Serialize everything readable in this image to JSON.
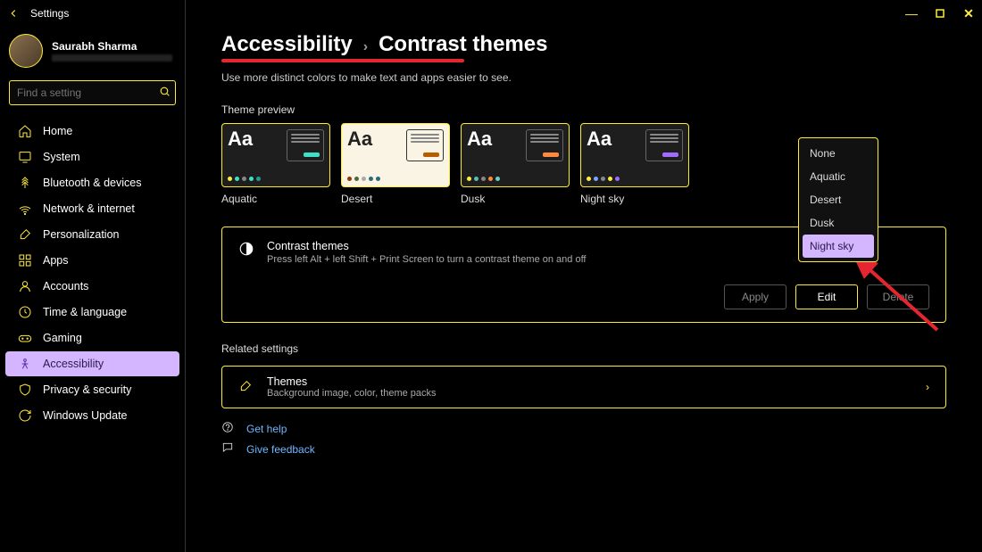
{
  "app": {
    "title": "Settings"
  },
  "user": {
    "name": "Saurabh Sharma"
  },
  "search": {
    "placeholder": "Find a setting"
  },
  "nav": {
    "items": [
      {
        "label": "Home"
      },
      {
        "label": "System"
      },
      {
        "label": "Bluetooth & devices"
      },
      {
        "label": "Network & internet"
      },
      {
        "label": "Personalization"
      },
      {
        "label": "Apps"
      },
      {
        "label": "Accounts"
      },
      {
        "label": "Time & language"
      },
      {
        "label": "Gaming"
      },
      {
        "label": "Accessibility"
      },
      {
        "label": "Privacy & security"
      },
      {
        "label": "Windows Update"
      }
    ],
    "active_index": 9
  },
  "breadcrumb": {
    "parent": "Accessibility",
    "sep": "›",
    "current": "Contrast themes"
  },
  "description": "Use more distinct colors to make text and apps easier to see.",
  "preview_label": "Theme preview",
  "themes": [
    {
      "name": "Aquatic",
      "bg": "dark",
      "accent": "#3fe0c5",
      "dots": [
        "#ffeb3b",
        "#3fe0c5",
        "#888",
        "#3fe0c5",
        "#209e8a"
      ]
    },
    {
      "name": "Desert",
      "bg": "light",
      "accent": "#b85c00",
      "dots": [
        "#903a00",
        "#4b6a35",
        "#aaa",
        "#2a6a7a",
        "#2a6a7a"
      ]
    },
    {
      "name": "Dusk",
      "bg": "dark",
      "accent": "#ff8a3d",
      "dots": [
        "#ffeb3b",
        "#54c1b5",
        "#888",
        "#ff8a3d",
        "#6ad0c0"
      ]
    },
    {
      "name": "Night sky",
      "bg": "dark",
      "accent": "#a06cff",
      "dots": [
        "#ffeb3b",
        "#7aa6ff",
        "#888",
        "#ffeb3b",
        "#a06cff"
      ]
    }
  ],
  "panel": {
    "title": "Contrast themes",
    "sub": "Press left Alt + left Shift + Print Screen to turn a contrast theme on and off",
    "apply": "Apply",
    "edit": "Edit",
    "delete": "Delete"
  },
  "dropdown": {
    "items": [
      "None",
      "Aquatic",
      "Desert",
      "Dusk",
      "Night sky"
    ],
    "selected_index": 4
  },
  "related": {
    "heading": "Related settings",
    "item": {
      "title": "Themes",
      "sub": "Background image, color, theme packs"
    }
  },
  "links": {
    "help": "Get help",
    "feedback": "Give feedback"
  }
}
